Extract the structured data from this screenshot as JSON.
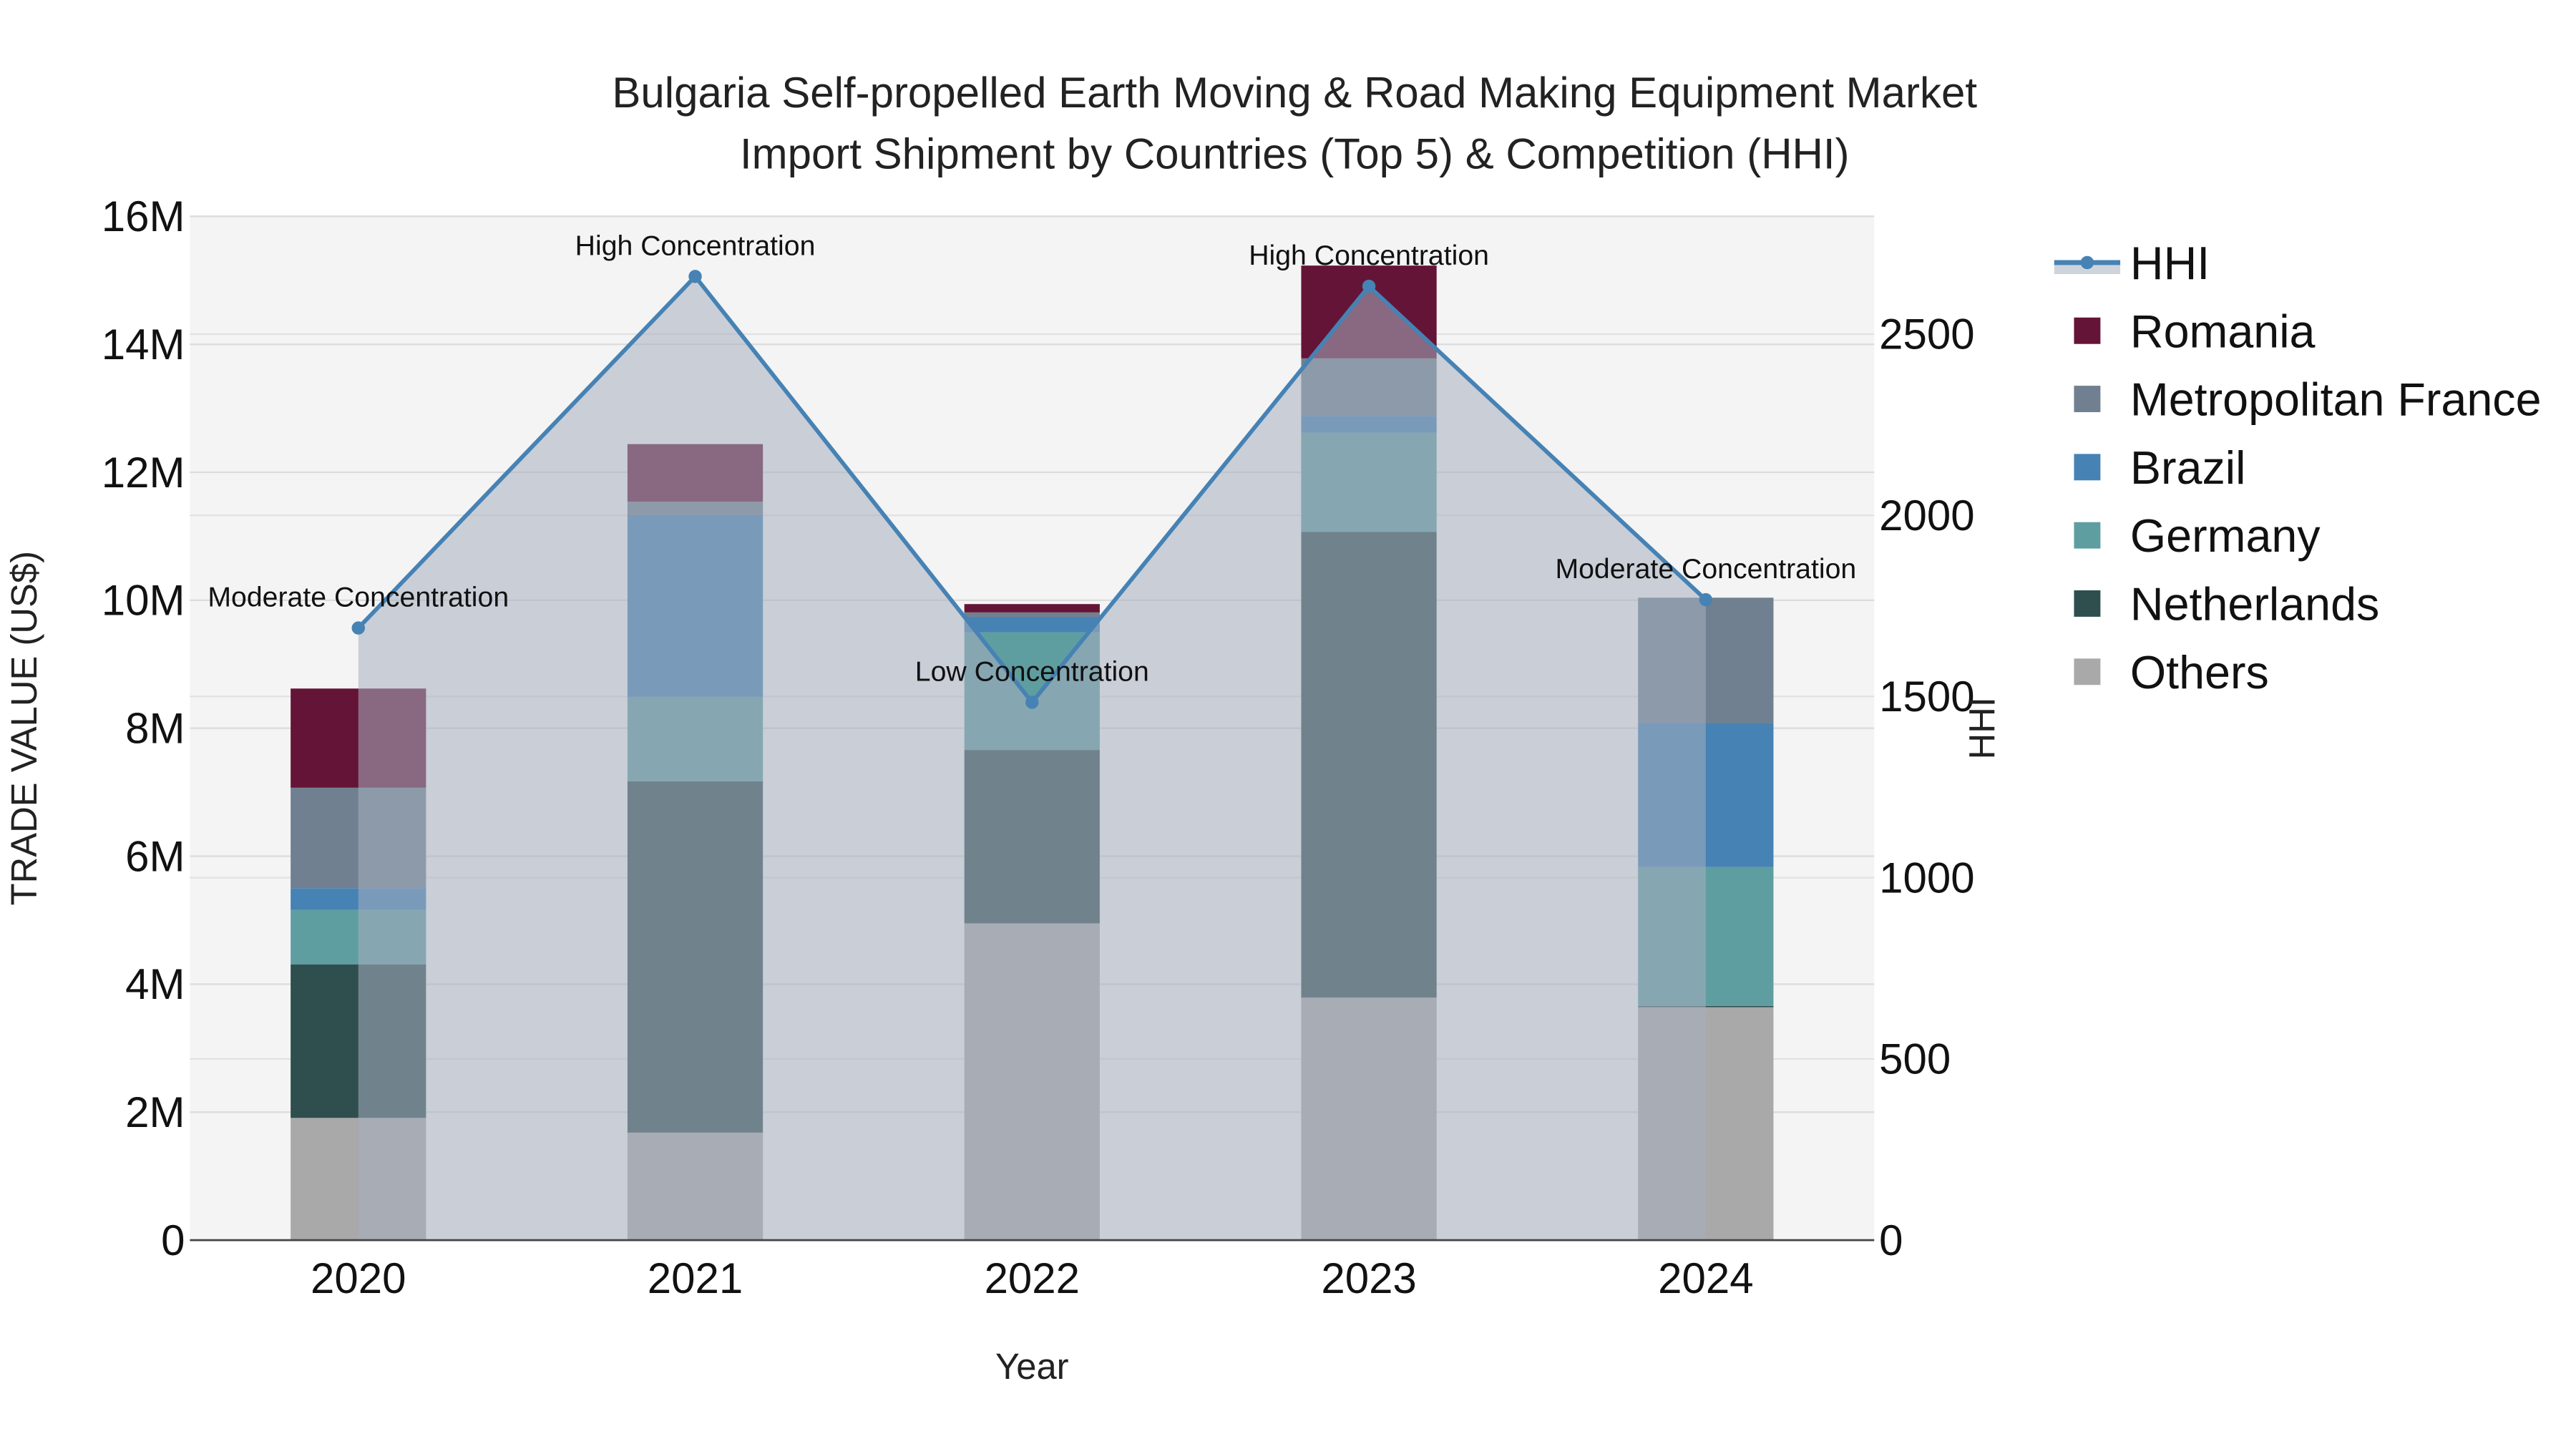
{
  "chart_data": {
    "type": "bar",
    "stacked": true,
    "title": "Bulgaria Self-propelled Earth Moving & Road Making Equipment Market",
    "subtitle": "Import Shipment by Countries (Top 5) & Competition (HHI)",
    "xlabel": "Year",
    "ylabel": "TRADE VALUE (US$)",
    "y2label": "HHI",
    "categories": [
      "2020",
      "2021",
      "2022",
      "2023",
      "2024"
    ],
    "ylim": [
      0,
      16000000
    ],
    "y_ticks": [
      0,
      2000000,
      4000000,
      6000000,
      8000000,
      10000000,
      12000000,
      14000000,
      16000000
    ],
    "y_tick_labels": [
      "0",
      "2M",
      "4M",
      "6M",
      "8M",
      "10M",
      "12M",
      "14M",
      "16M"
    ],
    "y2lim": [
      0,
      2825
    ],
    "y2_ticks": [
      0,
      500,
      1000,
      1500,
      2000,
      2500
    ],
    "y2_tick_labels": [
      "0",
      "500",
      "1000",
      "1500",
      "2000",
      "2500"
    ],
    "series": [
      {
        "name": "Others",
        "color": "#a9a9a9",
        "values": [
          1910000,
          1680000,
          4950000,
          3790000,
          3640000
        ]
      },
      {
        "name": "Netherlands",
        "color": "#2f4f4f",
        "values": [
          2400000,
          5490000,
          2710000,
          7280000,
          20000
        ]
      },
      {
        "name": "Germany",
        "color": "#5f9ea0",
        "values": [
          850000,
          1320000,
          1840000,
          1550000,
          2170000
        ]
      },
      {
        "name": "Brazil",
        "color": "#4682b4",
        "values": [
          340000,
          2840000,
          230000,
          260000,
          2250000
        ]
      },
      {
        "name": "Metropolitan France",
        "color": "#708090",
        "values": [
          1570000,
          210000,
          80000,
          900000,
          1960000
        ]
      },
      {
        "name": "Romania",
        "color": "#641436",
        "values": [
          1550000,
          900000,
          130000,
          1450000,
          0
        ]
      }
    ],
    "hhi": {
      "name": "HHI",
      "color": "#4682b4",
      "values": [
        1689,
        2659,
        1484,
        2632,
        1767
      ],
      "annotations": [
        "Moderate Concentration",
        "High Concentration",
        "Low Concentration",
        "High Concentration",
        "Moderate Concentration"
      ]
    },
    "legend_order": [
      "HHI",
      "Romania",
      "Metropolitan France",
      "Brazil",
      "Germany",
      "Netherlands",
      "Others"
    ],
    "legend_placement": "right",
    "grid": true
  }
}
